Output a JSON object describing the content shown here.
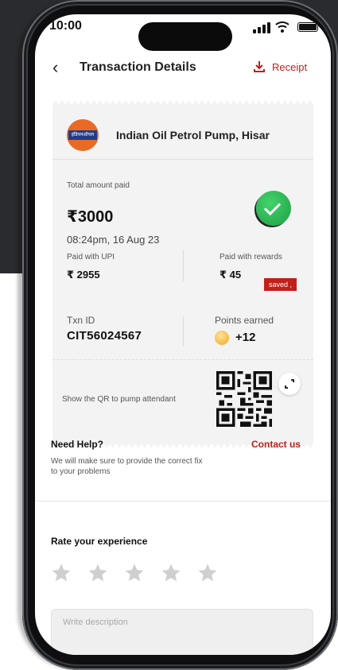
{
  "status_bar": {
    "time": "10:00"
  },
  "header": {
    "title": "Transaction Details",
    "receipt_label": "Receipt"
  },
  "merchant": {
    "name": "Indian Oil Petrol Pump, Hisar",
    "logo_text": "इंडियनऑयल"
  },
  "payment": {
    "total_label": "Total amount paid",
    "total_amount": "₹3000",
    "datetime": "08:24pm, 16 Aug 23",
    "upi_label": "Paid with UPI",
    "upi_amount": "₹ 2955",
    "rewards_label": "Paid with rewards",
    "rewards_amount": "₹ 45",
    "saved_badge": "saved ,"
  },
  "transaction": {
    "txn_label": "Txn ID",
    "txn_id": "CIT56024567",
    "points_label": "Points earned",
    "points_value": "+12"
  },
  "qr": {
    "text": "Show the QR to pump attendant"
  },
  "help": {
    "title": "Need Help?",
    "contact": "Contact us",
    "description": "We will make sure to provide the correct fix to your problems"
  },
  "rating": {
    "title": "Rate your experience",
    "stars_total": 5,
    "stars_selected": 0
  },
  "description_box": {
    "placeholder": "Write description",
    "value": ""
  },
  "colors": {
    "accent": "#c0201a",
    "success": "#1d9e45",
    "card_bg": "#f3f3f3"
  }
}
